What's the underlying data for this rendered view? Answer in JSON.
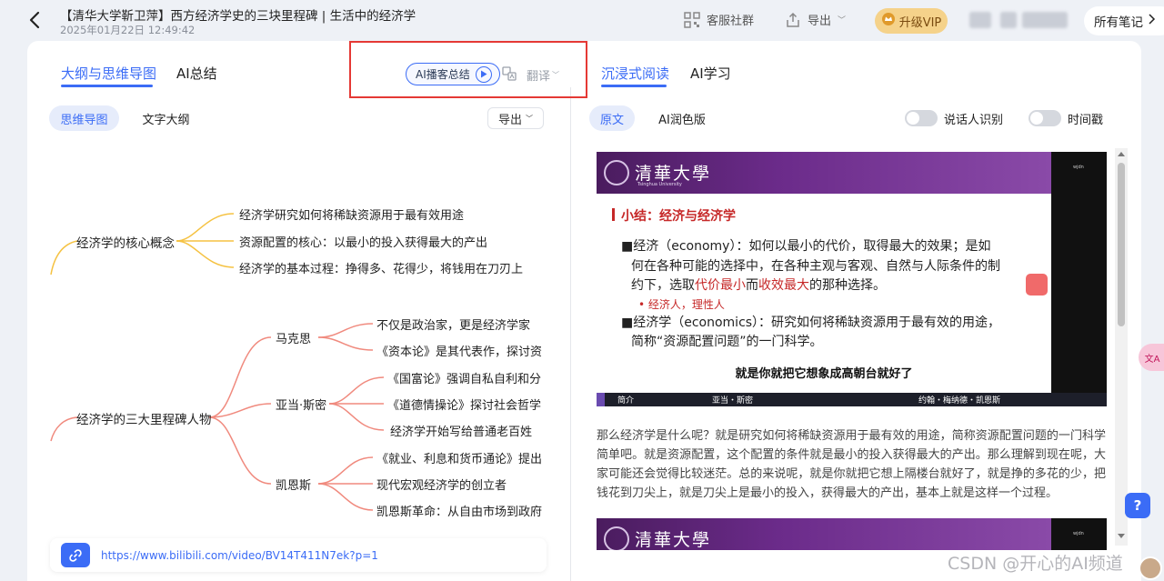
{
  "header": {
    "title": "【清华大学靳卫萍】西方经济学史的三块里程碑 | 生活中的经济学",
    "datetime": "2025年01月22日 12:49:42",
    "community_label": "客服社群",
    "export_label": "导出",
    "vip_label": "升级VIP",
    "all_notes_label": "所有笔记"
  },
  "left_panel": {
    "tabs": [
      {
        "label": "大纲与思维导图",
        "active": true
      },
      {
        "label": "AI总结",
        "active": false
      }
    ],
    "podcast_label": "AI播客总结",
    "translate_label": "翻译",
    "view_buttons": [
      {
        "label": "思维导图",
        "active": true
      },
      {
        "label": "文字大纲",
        "active": false
      }
    ],
    "export_label": "导出",
    "link_url": "https://www.bilibili.com/video/BV14T411N7ek?p=1"
  },
  "mindmap": {
    "nodes": [
      {
        "label": "经济学的核心概念",
        "children": [
          {
            "label": "经济学研究如何将稀缺资源用于最有效用途"
          },
          {
            "label": "资源配置的核心：以最小的投入获得最大的产出"
          },
          {
            "label": "经济学的基本过程：挣得多、花得少，将钱用在刀刃上"
          }
        ]
      },
      {
        "label": "经济学的三大里程碑人物",
        "children": [
          {
            "label": "马克思",
            "children": [
              {
                "label": "不仅是政治家，更是经济学家"
              },
              {
                "label": "《资本论》是其代表作，探讨资"
              }
            ]
          },
          {
            "label": "亚当·斯密",
            "children": [
              {
                "label": "《国富论》强调自私自利和分"
              },
              {
                "label": "《道德情操论》探讨社会哲学"
              },
              {
                "label": "经济学开始写给普通老百姓"
              }
            ]
          },
          {
            "label": "凯恩斯",
            "children": [
              {
                "label": "《就业、利息和货币通论》提出"
              },
              {
                "label": "现代宏观经济学的创立者"
              },
              {
                "label": "凯恩斯革命：从自由市场到政府"
              }
            ]
          }
        ]
      }
    ]
  },
  "right_panel": {
    "tabs": [
      {
        "label": "沉浸式阅读",
        "active": true
      },
      {
        "label": "AI学习",
        "active": false
      }
    ],
    "view_buttons": [
      {
        "label": "原文",
        "active": true
      },
      {
        "label": "AI润色版",
        "active": false
      }
    ],
    "speaker_toggle_label": "说话人识别",
    "timestamp_toggle_label": "时间戳"
  },
  "slide": {
    "university_name": "清華大學",
    "university_en": "Tsinghua University",
    "watermark": "wjdn",
    "title": "小结：经济与经济学",
    "economy_line1": "■经济（economy）：如何以最小的代价，取得最大的效果；是如",
    "economy_line2": "何在各种可能的选择中，在各种主观与客观、自然与人际条件的制",
    "economy_line3_a": "约下，选取",
    "economy_line3_red1": "代价最小",
    "economy_line3_b": "而",
    "economy_line3_red2": "收效最大",
    "economy_line3_c": "的那种选择。",
    "bullet": "• 经济人，理性人",
    "economics_line1": "■经济学（economics）：研究如何将稀缺资源用于最有效的用途，",
    "economics_line2": "简称“资源配置问题”的一门科学。",
    "subtitle": "就是你就把它想象成高朝台就好了",
    "footer": [
      "简介",
      "亚当・斯密",
      "约翰・梅纳德・凯恩斯"
    ]
  },
  "transcript": "那么经济学是什么呢？就是研究如何将稀缺资源用于最有效的用途，简称资源配置问题的一门科学简单吧。就是资源配置，这个配置的条件就是最小的投入获得最大的产出。那么理解到现在呢，大家可能还会觉得比较迷茫。总的来说呢，就是你就把它想上隔楼台就好了，就是挣的多花的少，把钱花到刀尖上，就是刀尖上是最小的投入，获得最大的产出，基本上就是这样一个过程。",
  "help_label": "?",
  "translate_float_label": "文A",
  "watermark": "CSDN @开心的AI频道",
  "colors": {
    "accent": "#3b6cf6",
    "branch_yellow": "#f5c242",
    "branch_red": "#f08a7e",
    "highlight_red": "#e53935",
    "vip": "#f5d28a"
  }
}
